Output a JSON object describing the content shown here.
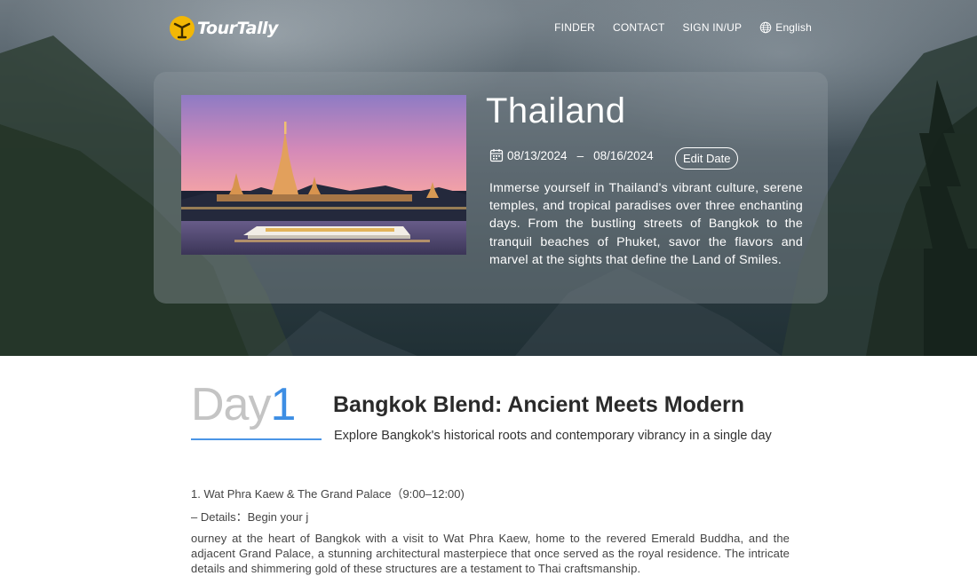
{
  "brand": {
    "name": "TourTally"
  },
  "nav": {
    "items": [
      {
        "label": "FINDER"
      },
      {
        "label": "CONTACT"
      },
      {
        "label": "SIGN IN/UP"
      }
    ],
    "language": {
      "label": "English",
      "icon": "globe-icon"
    }
  },
  "trip": {
    "title": "Thailand",
    "start_date": "08/13/2024",
    "date_separator": "–",
    "end_date": "08/16/2024",
    "edit_date_label": "Edit Date",
    "description": "Immerse yourself in Thailand's vibrant culture, serene temples, and tropical paradises over three enchanting days. From the bustling streets of Bangkok to the tranquil beaches of Phuket, savor the flavors and marvel at the sights that define the Land of Smiles."
  },
  "day": {
    "word": "Day",
    "number": "1",
    "title": "Bangkok Blend: Ancient Meets Modern",
    "subtitle": "Explore Bangkok's historical roots and contemporary vibrancy in a single day",
    "items": [
      {
        "title": "1. Wat Phra Kaew & The Grand Palace（9:00–12:00)",
        "details": "– Details：Begin your j",
        "body": "ourney at the heart of Bangkok with a visit to Wat Phra Kaew, home to the revered Emerald Buddha, and the adjacent Grand Palace, a stunning architectural masterpiece that once served as the royal residence. The intricate details and shimmering gold of these structures are a testament to Thai craftsmanship."
      }
    ]
  },
  "colors": {
    "accent": "#3d8ee4",
    "day_word": "#c4c4c4"
  }
}
